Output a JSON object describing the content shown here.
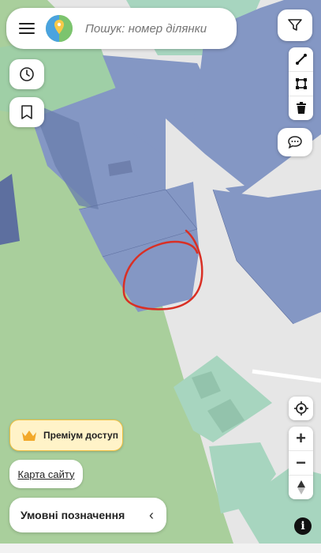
{
  "search": {
    "placeholder": "Пошук: номер ділянки"
  },
  "premium": {
    "label": "Преміум доступ"
  },
  "sitemap": {
    "label": "Карта сайту"
  },
  "legend": {
    "label": "Умовні позначення",
    "chevron": "‹"
  },
  "zoom": {
    "in": "+",
    "out": "−"
  },
  "info": {
    "label": "i"
  },
  "icons": {
    "menu": "menu-icon",
    "logo": "app-logo",
    "filter": "filter-icon",
    "history": "clock-icon",
    "bookmark": "bookmark-icon",
    "ruler": "ruler-icon",
    "polygon": "polygon-icon",
    "trash": "trash-icon",
    "comment": "comment-icon",
    "locate": "locate-icon",
    "compass": "compass-icon",
    "crown": "crown-icon"
  },
  "colors": {
    "parcel_blue": "#8497c4",
    "parcel_dark": "#5d6f9f",
    "forest_green": "#a9cf9c",
    "teal": "#a7d5bf",
    "road": "#e6e6e6",
    "annotation": "#d93025",
    "premium_bg": "#fff3c8",
    "premium_border": "#f0c040"
  }
}
